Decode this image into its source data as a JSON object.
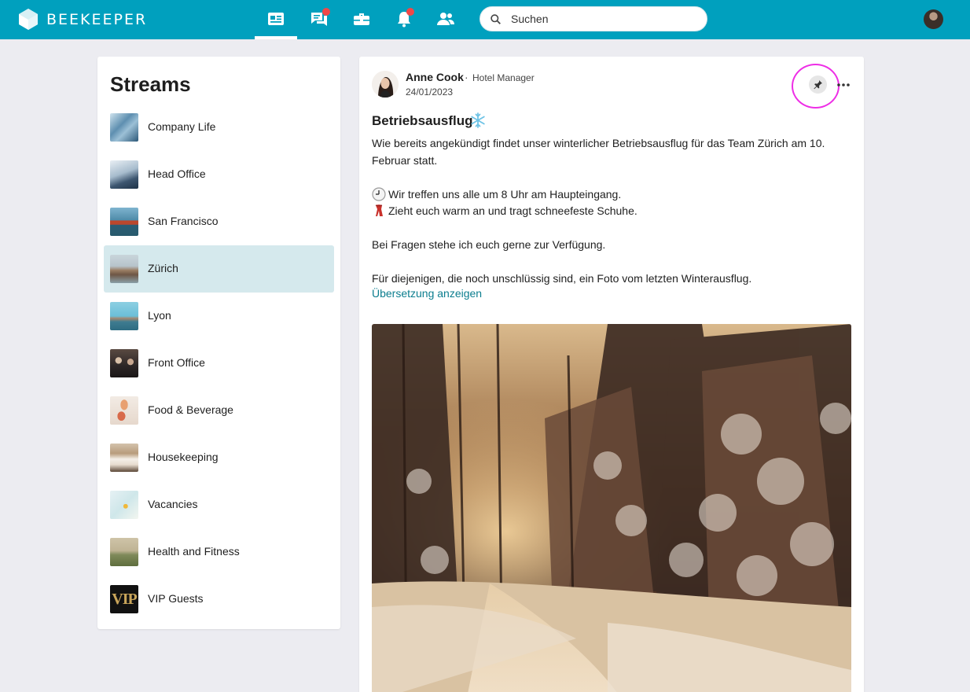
{
  "app": {
    "brand": "BEEKEEPER",
    "accent": "#00a0be"
  },
  "topnav": {
    "icons": [
      "newsfeed-icon",
      "chat-icon",
      "toolbox-icon",
      "bell-icon",
      "people-icon"
    ],
    "active": "newsfeed-icon",
    "notification_badges": [
      "chat-icon",
      "bell-icon"
    ],
    "badge_color": "#f04848"
  },
  "search": {
    "placeholder": "Suchen"
  },
  "streams": {
    "title": "Streams",
    "active": "Zürich",
    "items": [
      {
        "label": "Company Life"
      },
      {
        "label": "Head Office"
      },
      {
        "label": "San Francisco"
      },
      {
        "label": "Zürich"
      },
      {
        "label": "Lyon"
      },
      {
        "label": "Front Office"
      },
      {
        "label": "Food & Beverage"
      },
      {
        "label": "Housekeeping"
      },
      {
        "label": "Vacancies"
      },
      {
        "label": "Health and Fitness"
      },
      {
        "label": "VIP Guests"
      }
    ]
  },
  "post": {
    "author": "Anne Cook",
    "separator": "·",
    "role": "Hotel Manager",
    "date": "24/01/2023",
    "title": "Betriebsausflug",
    "title_emoji": "snowflake-icon",
    "body": [
      "Wie bereits angekündigt findet unser winterlicher Betriebsausflug für das Team Zürich am 10. Februar statt.",
      "",
      "Wir treffen uns alle um 8 Uhr am Haupteingang.",
      "Zieht euch warm an und tragt schneefeste Schuhe.",
      "",
      "Bei Fragen stehe ich euch gerne zur Verfügung.",
      "",
      "Für diejenigen, die noch unschlüssig sind, ein Foto vom letzten Winterausflug."
    ],
    "translate_link": "Übersetzung anzeigen",
    "link_color": "#0b7d8e"
  }
}
